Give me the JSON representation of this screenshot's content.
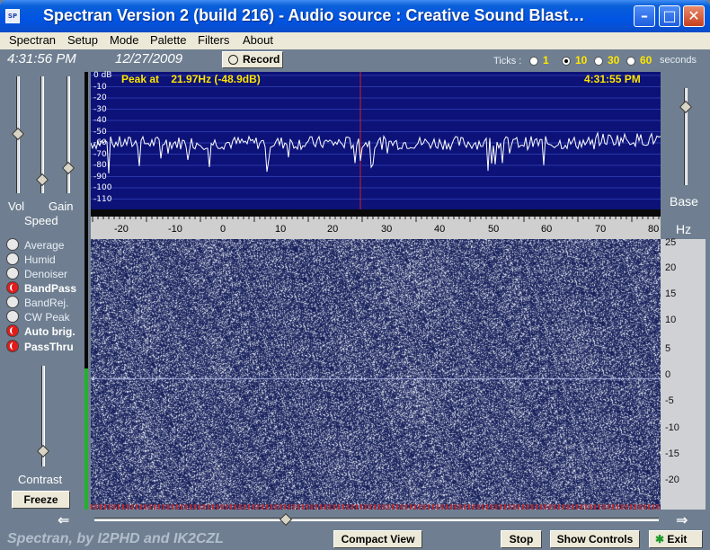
{
  "window": {
    "title": "Spectran Version 2 (build 216) - Audio source  :  Creative Sound Blast…",
    "icon": "spectran-app-icon",
    "controls": [
      "minimize",
      "maximize",
      "close"
    ]
  },
  "menu": [
    "Spectran",
    "Setup",
    "Mode",
    "Palette",
    "Filters",
    "About"
  ],
  "header": {
    "clock": "4:31:56 PM",
    "date": "12/27/2009",
    "record_label": "Record",
    "ticks_label": "Ticks :",
    "tick_options": [
      "1",
      "10",
      "30",
      "60"
    ],
    "tick_selected": "10",
    "seconds_label": "seconds"
  },
  "left_panel": {
    "vol_label": "Vol",
    "gain_label": "Gain",
    "speed_label": "Speed",
    "vol_level": 0.52,
    "gain_level": 0.2,
    "speed_level": 0.24,
    "options": [
      {
        "label": "Average",
        "on": false
      },
      {
        "label": "Humid",
        "on": false
      },
      {
        "label": "Denoiser",
        "on": false
      },
      {
        "label": "BandPass",
        "on": true
      },
      {
        "label": "BandRej.",
        "on": false
      },
      {
        "label": "CW Peak",
        "on": false
      },
      {
        "label": "Auto brig.",
        "on": true
      },
      {
        "label": "PassThru",
        "on": true
      }
    ],
    "contrast_label": "Contrast",
    "contrast_level": 0.2,
    "freeze_label": "Freeze"
  },
  "spectrum": {
    "db_labels": [
      "0 dB",
      "-10",
      "-20",
      "-30",
      "-40",
      "-50",
      "-60",
      "-70",
      "-80",
      "-90",
      "-100",
      "-110"
    ],
    "peak_prefix": "Peak at",
    "peak_value": "21.97Hz (-48.9dB)",
    "time": "4:31:55 PM",
    "freq_labels": [
      "-20",
      "-10",
      "0",
      "10",
      "20",
      "30",
      "40",
      "50",
      "60",
      "70",
      "80"
    ],
    "colors": {
      "background": "#0c1278",
      "trace": "#ffffff",
      "marker": "#d02020"
    }
  },
  "right_panel": {
    "base_label": "Base",
    "base_level": 0.8,
    "hz_label": "Hz",
    "hz_ticks": [
      "25",
      "20",
      "15",
      "10",
      "5",
      "0",
      "-5",
      "-10",
      "-15",
      "-20"
    ]
  },
  "bottom": {
    "credits": "Spectran, by I2PHD and IK2CZL",
    "compact_view_label": "Compact View",
    "stop_label": "Stop",
    "show_controls_label": "Show Controls",
    "exit_label": "Exit"
  }
}
